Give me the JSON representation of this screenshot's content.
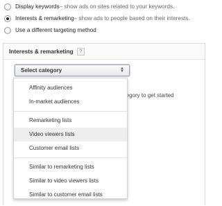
{
  "targeting": {
    "options": [
      {
        "label": "Display keywords",
        "description": " – show ads on sites related to your keywords.",
        "checked": false
      },
      {
        "label": "Interests & remarketing",
        "description": " – show ads to people based on their interests.",
        "checked": true
      },
      {
        "label": "Use a different targeting method",
        "description": "",
        "checked": false
      }
    ]
  },
  "interests": {
    "title": "Interests & remarketing",
    "help": "?",
    "select": {
      "value": "Select category"
    },
    "hint": "ategory to get started"
  },
  "menu": {
    "groups": [
      [
        "Affinity audiences",
        "In-market audiences"
      ],
      [
        "Remarketing lists",
        "Video viewers lists",
        "Customer email lists"
      ],
      [
        "Similar to remarketing lists",
        "Similar to video viewers lists",
        "Similar to customer email lists"
      ]
    ],
    "hovered": "Video viewers lists"
  }
}
